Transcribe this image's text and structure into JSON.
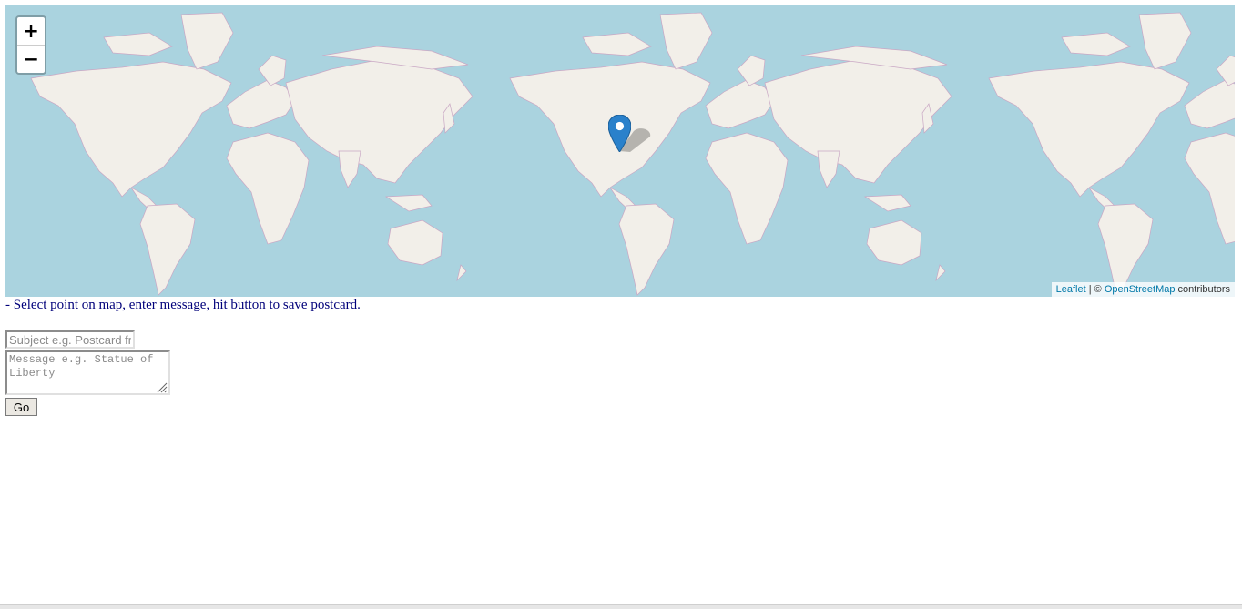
{
  "map": {
    "zoom_in_label": "+",
    "zoom_out_label": "−",
    "attribution": {
      "leaflet_link": "Leaflet",
      "separator": " | © ",
      "osm_link": "OpenStreetMap",
      "suffix": " contributors"
    },
    "colors": {
      "water": "#aad3df",
      "land": "#f2efe9",
      "marker": "#2a81cb"
    }
  },
  "instructions": "- Select point on map, enter message, hit button to save postcard.",
  "form": {
    "subject_placeholder": "Subject e.g. Postcard from NYC",
    "message_placeholder": "Message e.g. Statue of Liberty",
    "go_label": "Go"
  }
}
